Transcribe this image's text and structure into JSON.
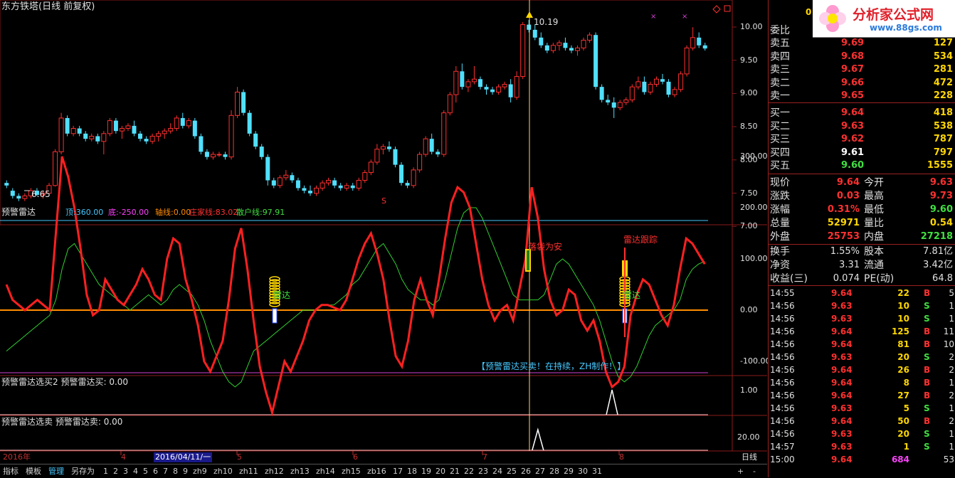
{
  "window": {
    "title": "东方铁塔(日线 前复权)"
  },
  "price_panel": {
    "axis_labels": [
      "10.00",
      "9.50",
      "9.00",
      "8.50",
      "8.00",
      "7.50",
      "7.00"
    ],
    "high_label": "10.19",
    "low_label": "6.65",
    "s_marker": "S",
    "top_right_value": "0"
  },
  "indicator_panel": {
    "name": "预警雷达",
    "params": [
      {
        "label": "顶:",
        "value": "360.00",
        "color": "#46c8ff"
      },
      {
        "label": "底:",
        "value": "-250.00",
        "color": "#ff40ff"
      },
      {
        "label": "轴线:",
        "value": "0.00",
        "color": "#ff8c00"
      },
      {
        "label": "庄家线:",
        "value": "83.02",
        "color": "#ff3030"
      },
      {
        "label": "散户线:",
        "value": "97.91",
        "color": "#40e040"
      }
    ],
    "axis_labels": [
      "300.00",
      "200.00",
      "100.00",
      "0.00",
      "-100.00"
    ],
    "radar_label_1": "雷达",
    "radar_label_2": "雷达",
    "safe_label": "落袋为安",
    "track_label": "雷达跟踪",
    "footer_note": "【预警雷达买卖！在持续，ZH制作！】"
  },
  "buy_panel": {
    "name": "预警雷达选买2",
    "value_label": "预警雷达买:",
    "value": "0.00",
    "axis_label": "1.00"
  },
  "sell_panel": {
    "name": "预警雷达选卖",
    "value_label": "预警雷达卖:",
    "value": "0.00",
    "axis_label": "20.00"
  },
  "date_axis": {
    "year": "2016年",
    "cursor_date": "2016/04/11/一",
    "months": [
      "4",
      "5",
      "6",
      "7",
      "8"
    ],
    "period": "日线"
  },
  "bottom_tabs": [
    "指标",
    "模板",
    "管理",
    "另存为",
    "1",
    "2",
    "3",
    "4",
    "5",
    "6",
    "7",
    "8",
    "9",
    "zh9",
    "zh10",
    "zh11",
    "zh12",
    "zh13",
    "zh14",
    "zh15",
    "zb16",
    "17",
    "18",
    "19",
    "20",
    "21",
    "22",
    "23",
    "24",
    "25",
    "26",
    "27",
    "28",
    "29",
    "30",
    "31"
  ],
  "bottom_controls": [
    "+",
    "-"
  ],
  "logo": {
    "text": "分析家公式网",
    "url": "www.88gs.com"
  },
  "order_book": {
    "weibi_label": "委比",
    "sell": [
      {
        "label": "卖五",
        "price": "9.69",
        "vol": "127"
      },
      {
        "label": "卖四",
        "price": "9.68",
        "vol": "534"
      },
      {
        "label": "卖三",
        "price": "9.67",
        "vol": "281"
      },
      {
        "label": "卖二",
        "price": "9.66",
        "vol": "472"
      },
      {
        "label": "卖一",
        "price": "9.65",
        "vol": "228"
      }
    ],
    "buy": [
      {
        "label": "买一",
        "price": "9.64",
        "vol": "418"
      },
      {
        "label": "买二",
        "price": "9.63",
        "vol": "538"
      },
      {
        "label": "买三",
        "price": "9.62",
        "vol": "787"
      },
      {
        "label": "买四",
        "price": "9.61",
        "vol": "797"
      },
      {
        "label": "买五",
        "price": "9.60",
        "vol": "1555"
      }
    ]
  },
  "quote": [
    {
      "l1": "现价",
      "v1": "9.64",
      "l2": "今开",
      "v2": "9.63",
      "c1": "#ff3030",
      "c2": "#ff3030"
    },
    {
      "l1": "涨跌",
      "v1": "0.03",
      "l2": "最高",
      "v2": "9.73",
      "c1": "#ff3030",
      "c2": "#ff3030"
    },
    {
      "l1": "涨幅",
      "v1": "0.31%",
      "l2": "最低",
      "v2": "9.60",
      "c1": "#ff3030",
      "c2": "#40e040"
    },
    {
      "l1": "总量",
      "v1": "52971",
      "l2": "量比",
      "v2": "0.54",
      "c1": "#ffd700",
      "c2": "#ffd700"
    },
    {
      "l1": "外盘",
      "v1": "25753",
      "l2": "内盘",
      "v2": "27218",
      "c1": "#ff3030",
      "c2": "#40e040"
    }
  ],
  "stats": [
    {
      "l1": "换手",
      "v1": "1.55%",
      "l2": "股本",
      "v2": "7.81亿"
    },
    {
      "l1": "净资",
      "v1": "3.31",
      "l2": "流通",
      "v2": "3.42亿"
    },
    {
      "l1": "收益(三)",
      "v1": "0.074",
      "l2": "PE(动)",
      "v2": "64.8"
    }
  ],
  "ticks": [
    {
      "t": "14:55",
      "p": "9.64",
      "v": "22",
      "s": "B",
      "n": "5"
    },
    {
      "t": "14:56",
      "p": "9.63",
      "v": "10",
      "s": "S",
      "n": "1"
    },
    {
      "t": "14:56",
      "p": "9.63",
      "v": "10",
      "s": "S",
      "n": "1"
    },
    {
      "t": "14:56",
      "p": "9.64",
      "v": "125",
      "s": "B",
      "n": "11"
    },
    {
      "t": "14:56",
      "p": "9.64",
      "v": "81",
      "s": "B",
      "n": "10"
    },
    {
      "t": "14:56",
      "p": "9.63",
      "v": "20",
      "s": "S",
      "n": "2"
    },
    {
      "t": "14:56",
      "p": "9.64",
      "v": "26",
      "s": "B",
      "n": "2"
    },
    {
      "t": "14:56",
      "p": "9.64",
      "v": "8",
      "s": "B",
      "n": "1"
    },
    {
      "t": "14:56",
      "p": "9.64",
      "v": "27",
      "s": "B",
      "n": "2"
    },
    {
      "t": "14:56",
      "p": "9.63",
      "v": "5",
      "s": "S",
      "n": "1"
    },
    {
      "t": "14:56",
      "p": "9.64",
      "v": "50",
      "s": "B",
      "n": "2"
    },
    {
      "t": "14:56",
      "p": "9.63",
      "v": "20",
      "s": "S",
      "n": "1"
    },
    {
      "t": "14:57",
      "p": "9.63",
      "v": "1",
      "s": "S",
      "n": "1"
    },
    {
      "t": "15:00",
      "p": "9.64",
      "v": "684",
      "s": "",
      "n": "53"
    }
  ],
  "colors": {
    "up": "#ff3030",
    "down": "#50e0ff",
    "main_line": "#ff2020",
    "retail_line": "#30d030",
    "axis": "#ff8c00"
  },
  "chart_data": {
    "type": "candlestick",
    "y_range": [
      6.6,
      10.3
    ],
    "candles": [
      [
        7.05,
        7.1,
        6.95,
        7.0
      ],
      [
        6.9,
        6.95,
        6.75,
        6.8
      ],
      [
        6.8,
        6.85,
        6.7,
        6.75
      ],
      [
        6.75,
        6.85,
        6.7,
        6.8
      ],
      [
        6.8,
        6.95,
        6.75,
        6.9
      ],
      [
        6.9,
        6.95,
        6.8,
        6.82
      ],
      [
        6.82,
        6.9,
        6.75,
        6.85
      ],
      [
        6.85,
        7.05,
        6.8,
        7.0
      ],
      [
        7.0,
        7.7,
        6.98,
        7.65
      ],
      [
        7.65,
        8.4,
        7.6,
        8.3
      ],
      [
        8.3,
        8.35,
        7.95,
        8.0
      ],
      [
        8.0,
        8.15,
        7.95,
        8.1
      ],
      [
        8.1,
        8.15,
        7.95,
        8.0
      ],
      [
        8.0,
        8.05,
        7.85,
        7.9
      ],
      [
        7.9,
        8.0,
        7.85,
        7.95
      ],
      [
        7.95,
        8.0,
        7.8,
        7.85
      ],
      [
        7.85,
        8.05,
        7.6,
        8.0
      ],
      [
        8.0,
        8.3,
        7.95,
        8.25
      ],
      [
        8.25,
        8.3,
        8.0,
        8.05
      ],
      [
        8.05,
        8.15,
        7.9,
        8.1
      ],
      [
        8.1,
        8.2,
        8.05,
        8.15
      ],
      [
        8.15,
        8.25,
        7.95,
        8.0
      ],
      [
        8.0,
        8.05,
        7.85,
        7.9
      ],
      [
        7.9,
        7.95,
        7.8,
        7.85
      ],
      [
        7.85,
        8.0,
        7.8,
        7.95
      ],
      [
        7.95,
        8.05,
        7.85,
        8.0
      ],
      [
        8.0,
        8.1,
        7.9,
        8.05
      ],
      [
        8.05,
        8.2,
        8.0,
        8.1
      ],
      [
        8.1,
        8.35,
        8.05,
        8.3
      ],
      [
        8.3,
        8.4,
        8.1,
        8.15
      ],
      [
        8.15,
        8.3,
        8.1,
        8.25
      ],
      [
        8.25,
        8.3,
        7.9,
        7.95
      ],
      [
        7.95,
        8.0,
        7.6,
        7.65
      ],
      [
        7.65,
        7.7,
        7.5,
        7.55
      ],
      [
        7.55,
        7.65,
        7.5,
        7.6
      ],
      [
        7.6,
        7.65,
        7.55,
        7.6
      ],
      [
        7.6,
        7.65,
        7.5,
        7.55
      ],
      [
        7.55,
        8.45,
        7.5,
        8.35
      ],
      [
        8.35,
        8.9,
        8.3,
        8.8
      ],
      [
        8.8,
        8.85,
        8.35,
        8.4
      ],
      [
        8.4,
        8.45,
        7.95,
        8.0
      ],
      [
        8.0,
        8.05,
        7.7,
        7.75
      ],
      [
        7.75,
        7.8,
        7.5,
        7.55
      ],
      [
        7.55,
        7.6,
        7.0,
        7.1
      ],
      [
        7.1,
        7.15,
        6.95,
        7.0
      ],
      [
        7.0,
        7.2,
        6.95,
        7.15
      ],
      [
        7.15,
        7.3,
        7.1,
        7.2
      ],
      [
        7.2,
        7.25,
        7.05,
        7.1
      ],
      [
        7.1,
        7.15,
        6.9,
        6.95
      ],
      [
        6.95,
        7.0,
        6.85,
        6.9
      ],
      [
        6.9,
        7.0,
        6.8,
        6.85
      ],
      [
        6.85,
        7.0,
        6.8,
        6.95
      ],
      [
        6.95,
        7.1,
        6.9,
        7.05
      ],
      [
        7.05,
        7.15,
        7.0,
        7.1
      ],
      [
        7.1,
        7.15,
        6.95,
        7.0
      ],
      [
        7.0,
        7.05,
        6.9,
        6.95
      ],
      [
        6.95,
        7.05,
        6.9,
        7.0
      ],
      [
        7.0,
        7.05,
        6.9,
        6.95
      ],
      [
        6.95,
        7.15,
        6.9,
        7.1
      ],
      [
        7.1,
        7.3,
        7.05,
        7.25
      ],
      [
        7.25,
        7.5,
        7.2,
        7.45
      ],
      [
        7.45,
        7.8,
        7.4,
        7.7
      ],
      [
        7.7,
        7.8,
        7.6,
        7.75
      ],
      [
        7.75,
        7.85,
        7.65,
        7.7
      ],
      [
        7.7,
        7.75,
        7.35,
        7.4
      ],
      [
        7.4,
        7.45,
        7.0,
        7.05
      ],
      [
        7.05,
        7.1,
        6.95,
        7.0
      ],
      [
        7.0,
        7.35,
        6.95,
        7.3
      ],
      [
        7.3,
        7.65,
        7.25,
        7.6
      ],
      [
        7.6,
        7.95,
        7.55,
        7.9
      ],
      [
        7.9,
        8.0,
        7.6,
        7.65
      ],
      [
        7.65,
        7.7,
        7.55,
        7.6
      ],
      [
        7.6,
        8.45,
        7.55,
        8.4
      ],
      [
        8.4,
        8.8,
        8.35,
        8.75
      ],
      [
        8.75,
        9.3,
        8.6,
        9.2
      ],
      [
        9.2,
        9.35,
        8.85,
        8.9
      ],
      [
        8.9,
        9.05,
        8.8,
        9.0
      ],
      [
        9.0,
        9.3,
        8.95,
        9.05
      ],
      [
        9.05,
        9.1,
        8.85,
        8.9
      ],
      [
        8.9,
        8.95,
        8.75,
        8.85
      ],
      [
        8.85,
        8.9,
        8.75,
        8.8
      ],
      [
        8.8,
        8.95,
        8.75,
        8.9
      ],
      [
        8.9,
        9.0,
        8.85,
        8.95
      ],
      [
        8.95,
        9.05,
        8.6,
        8.7
      ],
      [
        8.7,
        9.2,
        8.65,
        9.1
      ],
      [
        9.1,
        10.15,
        9.05,
        10.1
      ],
      [
        10.1,
        10.19,
        9.95,
        10.0
      ],
      [
        10.0,
        10.1,
        9.8,
        9.85
      ],
      [
        9.85,
        9.95,
        9.65,
        9.7
      ],
      [
        9.7,
        9.75,
        9.55,
        9.6
      ],
      [
        9.6,
        9.75,
        9.55,
        9.7
      ],
      [
        9.7,
        9.8,
        9.6,
        9.75
      ],
      [
        9.75,
        9.85,
        9.6,
        9.65
      ],
      [
        9.65,
        9.7,
        9.55,
        9.6
      ],
      [
        9.6,
        9.7,
        9.5,
        9.65
      ],
      [
        9.65,
        9.85,
        9.6,
        9.8
      ],
      [
        9.8,
        9.95,
        9.75,
        9.9
      ],
      [
        9.9,
        9.95,
        8.85,
        8.9
      ],
      [
        8.9,
        8.95,
        8.6,
        8.65
      ],
      [
        8.65,
        8.75,
        8.55,
        8.6
      ],
      [
        8.6,
        8.7,
        8.3,
        8.5
      ],
      [
        8.5,
        8.65,
        8.45,
        8.6
      ],
      [
        8.6,
        8.7,
        8.55,
        8.65
      ],
      [
        8.65,
        8.95,
        8.6,
        8.9
      ],
      [
        8.9,
        9.1,
        8.85,
        9.0
      ],
      [
        9.0,
        9.1,
        8.75,
        8.8
      ],
      [
        8.8,
        9.0,
        8.75,
        8.95
      ],
      [
        8.95,
        9.1,
        8.9,
        9.05
      ],
      [
        9.05,
        9.15,
        8.95,
        9.0
      ],
      [
        9.0,
        9.05,
        8.7,
        8.75
      ],
      [
        8.75,
        8.9,
        8.7,
        8.85
      ],
      [
        8.85,
        9.2,
        8.8,
        9.15
      ],
      [
        9.15,
        9.7,
        9.1,
        9.65
      ],
      [
        9.65,
        10.05,
        9.6,
        9.85
      ],
      [
        9.85,
        9.95,
        9.65,
        9.7
      ],
      [
        9.7,
        9.75,
        9.6,
        9.64
      ]
    ],
    "main_line": [
      50,
      20,
      10,
      0,
      10,
      20,
      10,
      0,
      150,
      300,
      260,
      200,
      120,
      30,
      -10,
      0,
      60,
      40,
      20,
      10,
      30,
      50,
      80,
      60,
      30,
      20,
      100,
      140,
      130,
      60,
      20,
      -30,
      -100,
      -120,
      -90,
      -60,
      20,
      120,
      160,
      80,
      -20,
      -110,
      -160,
      -200,
      -150,
      -100,
      -120,
      -90,
      -60,
      -20,
      0,
      10,
      10,
      5,
      0,
      20,
      60,
      100,
      130,
      150,
      110,
      60,
      -20,
      -90,
      -110,
      -60,
      20,
      60,
      20,
      -10,
      60,
      140,
      210,
      240,
      230,
      200,
      130,
      60,
      10,
      -20,
      0,
      10,
      -20,
      40,
      100,
      240,
      180,
      80,
      20,
      -10,
      0,
      40,
      30,
      -20,
      -40,
      -20,
      -60,
      -120,
      -150,
      -140,
      -110,
      -10,
      30,
      60,
      50,
      20,
      -10,
      -30,
      10,
      80,
      140,
      130,
      110,
      90
    ],
    "retail_line": [
      -80,
      -70,
      -60,
      -50,
      -40,
      -30,
      -20,
      -10,
      20,
      80,
      120,
      130,
      110,
      90,
      70,
      50,
      40,
      30,
      20,
      10,
      0,
      10,
      20,
      30,
      20,
      10,
      20,
      40,
      50,
      40,
      30,
      10,
      -20,
      -60,
      -90,
      -120,
      -140,
      -150,
      -140,
      -110,
      -80,
      -70,
      -60,
      -50,
      -40,
      -30,
      -20,
      -10,
      0,
      0,
      0,
      10,
      10,
      10,
      20,
      30,
      50,
      60,
      80,
      100,
      120,
      130,
      110,
      90,
      60,
      40,
      30,
      20,
      20,
      10,
      20,
      60,
      110,
      160,
      190,
      200,
      200,
      180,
      150,
      120,
      90,
      60,
      30,
      20,
      20,
      20,
      20,
      30,
      60,
      90,
      100,
      90,
      70,
      50,
      30,
      10,
      -20,
      -60,
      -100,
      -130,
      -140,
      -130,
      -110,
      -80,
      -50,
      -30,
      -20,
      -10,
      0,
      20,
      60,
      80,
      90,
      95
    ],
    "buy_signal_index": 98,
    "sell_signal_index": 86
  }
}
